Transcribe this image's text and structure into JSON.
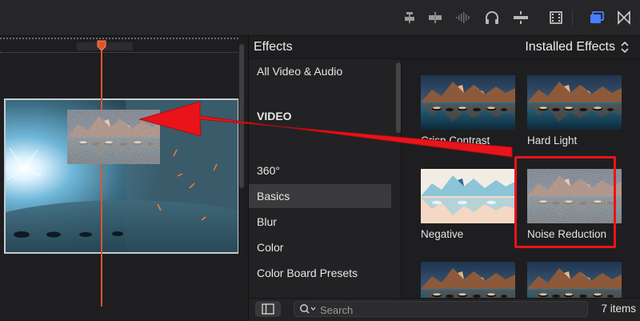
{
  "toolbar": {
    "icons": [
      "connect-clip-icon",
      "insert-clip-icon",
      "audio-waveform-icon",
      "headphones-icon",
      "snapping-icon",
      "filmstrip-icon",
      "browser-panels-icon",
      "transitions-bowtie-icon"
    ]
  },
  "effects": {
    "title": "Effects",
    "source_label": "Installed Effects",
    "categories": [
      {
        "label": "All Video & Audio"
      },
      {
        "label": "VIDEO"
      },
      {
        "label": "360°"
      },
      {
        "label": "Basics"
      },
      {
        "label": "Blur"
      },
      {
        "label": "Color"
      },
      {
        "label": "Color Board Presets"
      }
    ],
    "selected_category": "Basics",
    "items": [
      {
        "label": "Crisp Contrast"
      },
      {
        "label": "Hard Light"
      },
      {
        "label": "Negative"
      },
      {
        "label": "Noise Reduction"
      },
      {
        "label": ""
      },
      {
        "label": ""
      }
    ],
    "search_placeholder": "Search",
    "count_label": "7 items"
  },
  "colors": {
    "playhead": "#e0532d",
    "annotation": "#e8141a"
  }
}
